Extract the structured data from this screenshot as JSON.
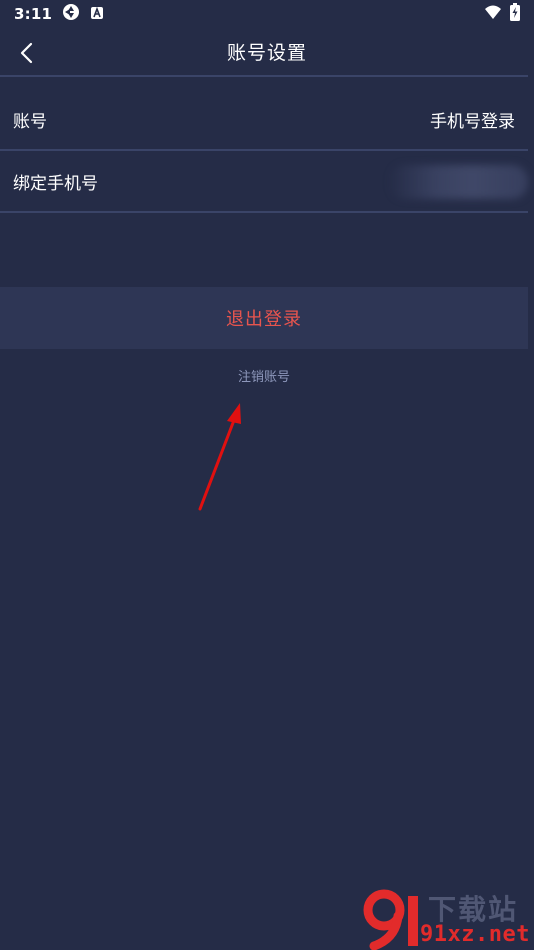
{
  "status_bar": {
    "time": "3:11",
    "icons": [
      "sync-icon",
      "a-badge-icon",
      "wifi-icon",
      "battery-charging-icon"
    ]
  },
  "header": {
    "title": "账号设置",
    "back_icon": "chevron-left-icon"
  },
  "rows": [
    {
      "label": "账号",
      "value": "手机号登录"
    },
    {
      "label": "绑定手机号",
      "value": ""
    }
  ],
  "logout": {
    "label": "退出登录"
  },
  "cancel_account": {
    "label": "注销账号"
  },
  "watermark": {
    "site": "91xz.net",
    "cn": "下载站"
  },
  "colors": {
    "background": "#252c47",
    "panel": "#2e3655",
    "divider": "#3a4468",
    "logout_text": "#e8554e",
    "link_text": "#8d97bb",
    "annotation_arrow": "#e01010"
  }
}
